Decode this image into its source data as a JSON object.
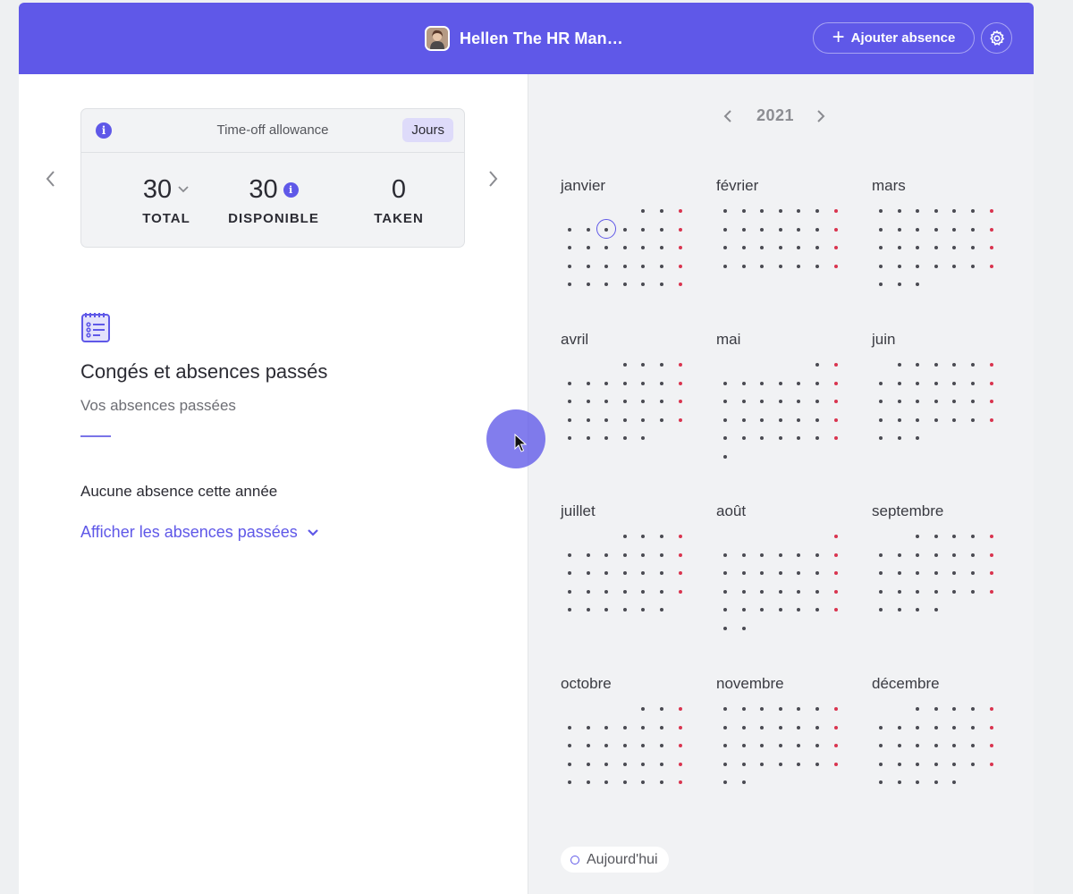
{
  "header": {
    "user_name": "Hellen The HR Man…",
    "add_absence_label": "Ajouter absence",
    "accent": "#5f58e8"
  },
  "allowance": {
    "title": "Time-off allowance",
    "unit_badge": "Jours",
    "stats": [
      {
        "value": "30",
        "label": "TOTAL"
      },
      {
        "value": "30",
        "label": "DISPONIBLE"
      },
      {
        "value": "0",
        "label": "TAKEN"
      }
    ]
  },
  "past": {
    "title": "Congés et absences passés",
    "subtitle": "Vos absences passées",
    "empty_text": "Aucune absence cette année",
    "show_link": "Afficher les absences passées"
  },
  "calendar": {
    "year": "2021",
    "today": {
      "month_index": 0,
      "day": 6
    },
    "weekend_color": "#d9344f",
    "months": [
      {
        "name": "janvier",
        "first_weekday": 5,
        "days": 31
      },
      {
        "name": "février",
        "first_weekday": 1,
        "days": 28
      },
      {
        "name": "mars",
        "first_weekday": 1,
        "days": 31
      },
      {
        "name": "avril",
        "first_weekday": 4,
        "days": 30
      },
      {
        "name": "mai",
        "first_weekday": 6,
        "days": 31
      },
      {
        "name": "juin",
        "first_weekday": 2,
        "days": 30
      },
      {
        "name": "juillet",
        "first_weekday": 4,
        "days": 31
      },
      {
        "name": "août",
        "first_weekday": 7,
        "days": 31
      },
      {
        "name": "septembre",
        "first_weekday": 3,
        "days": 30
      },
      {
        "name": "octobre",
        "first_weekday": 5,
        "days": 31
      },
      {
        "name": "novembre",
        "first_weekday": 1,
        "days": 30
      },
      {
        "name": "décembre",
        "first_weekday": 3,
        "days": 31
      }
    ],
    "legend_today": "Aujourd'hui"
  },
  "icons": {
    "info": "info-icon",
    "settings": "gear-icon",
    "add": "plus-icon",
    "past_absences": "checklist-icon",
    "prev": "chevron-left-icon",
    "next": "chevron-right-icon",
    "expand": "chevron-down-icon"
  }
}
